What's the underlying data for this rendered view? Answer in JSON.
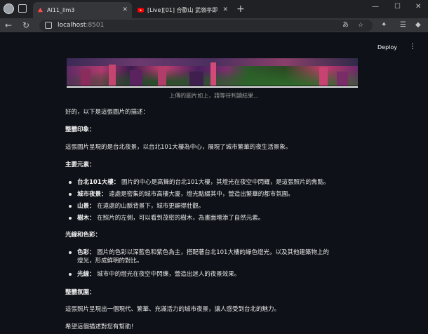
{
  "browser": {
    "tabs": [
      {
        "label": "AI11_llm3",
        "active": true
      },
      {
        "label": "[Live][01] 合歡山 武嶺亭即時影像",
        "active": false
      }
    ],
    "url_host": "localhost",
    "url_port": ":8501",
    "omni_icons": [
      "translate-icon",
      "star-icon"
    ],
    "colors": {
      "chrome_bg": "#202124",
      "active_tab": "#35363a",
      "youtube_red": "#ff0000"
    }
  },
  "app": {
    "deploy_label": "Deploy",
    "menu_glyph": "⋮",
    "caption": "上傳的圖片如上，請等待判讀結果...",
    "intro": "好的，以下是這張圖片的描述：",
    "sections": {
      "overall": {
        "heading": "整體印象：",
        "text": "這張圖片呈現的是台北夜景，以台北101大樓為中心，展現了城市繁華的夜生活景象。"
      },
      "elements": {
        "heading": "主要元素：",
        "items": [
          {
            "term": "台北101大樓：",
            "text": "圖片的中心是高聳的台北101大樓，其燈光在夜空中閃耀，是這張照片的焦點。"
          },
          {
            "term": "城市夜景：",
            "text": "遠處是密集的城市高樓大廈，燈光點綴其中，營造出繁華的都市氛圍。"
          },
          {
            "term": "山景：",
            "text": "在遠處的山脈背景下，城市更顯得壯觀。"
          },
          {
            "term": "樹木：",
            "text": "在照片的左側，可以看到茂密的樹木，為畫面增添了自然元素。"
          }
        ]
      },
      "lighting": {
        "heading": "光線和色彩：",
        "items": [
          {
            "term": "色彩：",
            "text": "圖片的色彩以深藍色和紫色為主，搭配著台北101大樓的綠色燈光，以及其他建築物上的",
            "text2": "燈光，形成鮮明的對比。"
          },
          {
            "term": "光線：",
            "text": "城市中的燈光在夜空中閃爍，營造出迷人的夜景效果。"
          }
        ]
      },
      "atmosphere": {
        "heading": "整體氛圍：",
        "text": "這張照片呈現出一個現代、繁華、充滿活力的城市夜景，讓人感受到台北的魅力。"
      }
    },
    "closing": "希望這個描述對您有幫助！"
  }
}
